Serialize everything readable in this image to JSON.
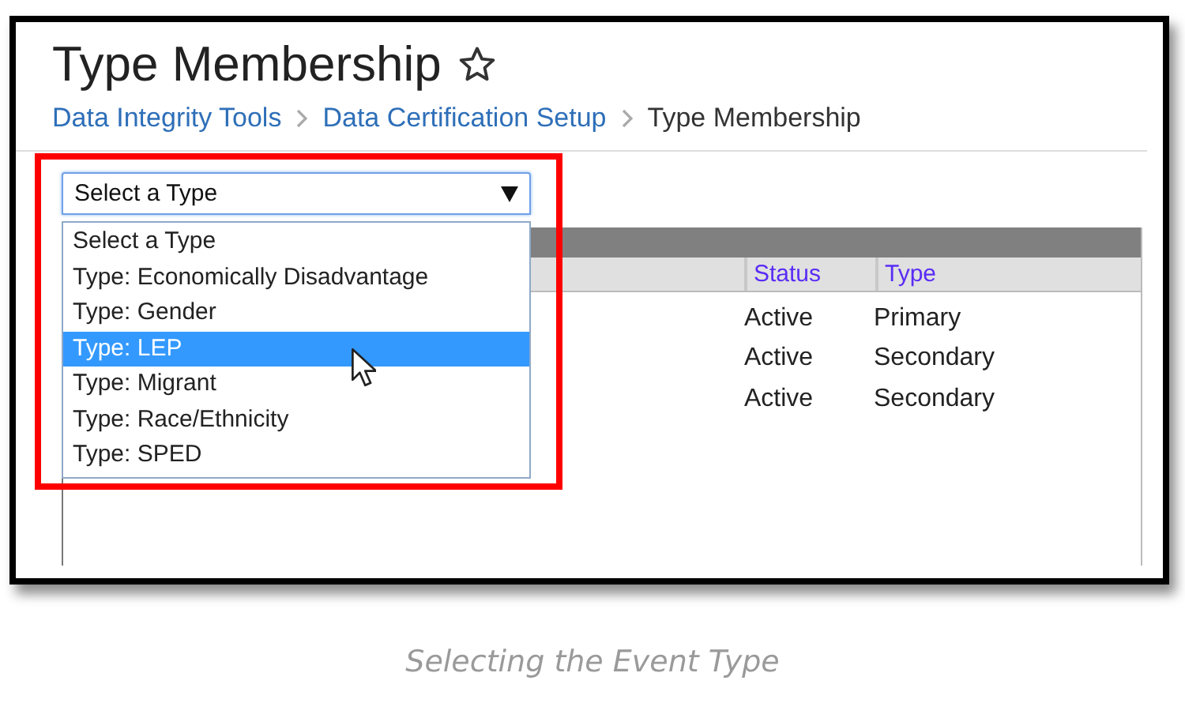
{
  "page": {
    "title": "Type Membership",
    "favorite": false
  },
  "breadcrumb": [
    {
      "label": "Data Integrity Tools",
      "kind": "link"
    },
    {
      "label": "Data Certification Setup",
      "kind": "link"
    },
    {
      "label": "Type Membership",
      "kind": "current"
    }
  ],
  "type_select": {
    "value": "Select a Type",
    "expanded": true
  },
  "type_options": [
    {
      "label": "Select a Type",
      "selected": false
    },
    {
      "label": "Type: Economically Disadvantage",
      "selected": false
    },
    {
      "label": "Type: Gender",
      "selected": false
    },
    {
      "label": "Type: LEP",
      "selected": true
    },
    {
      "label": "Type: Migrant",
      "selected": false
    },
    {
      "label": "Type: Race/Ethnicity",
      "selected": false
    },
    {
      "label": "Type: SPED",
      "selected": false
    }
  ],
  "table": {
    "columns": [
      "Status",
      "Type"
    ],
    "rows": [
      {
        "status": "Active",
        "type": "Primary"
      },
      {
        "status": "Active",
        "type": "Secondary"
      },
      {
        "status": "Active",
        "type": "Secondary"
      }
    ]
  },
  "caption": "Selecting the Event Type"
}
